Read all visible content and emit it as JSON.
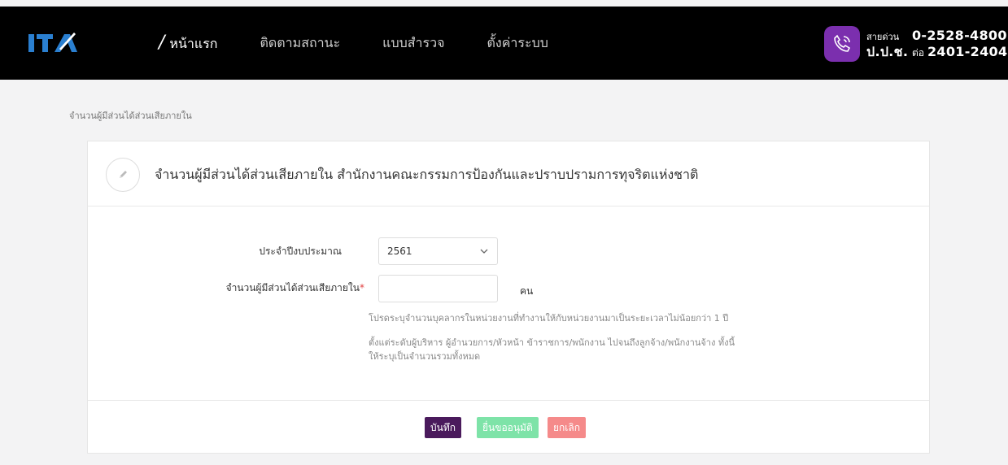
{
  "header": {
    "logo_text": "ITA",
    "nav": [
      {
        "label": "หน้าแรก",
        "active": true
      },
      {
        "label": "ติดตามสถานะ",
        "active": false
      },
      {
        "label": "แบบสำรวจ",
        "active": false
      },
      {
        "label": "ตั้งค่าระบบ",
        "active": false
      }
    ],
    "hotline": {
      "label1": "สายด่วน",
      "number1": "0-2528-4800",
      "label2": "ป.ป.ช.",
      "ext_label": "ต่อ",
      "number2": "2401-2404",
      "icon": "phone-icon",
      "color": "#7b2fae"
    }
  },
  "breadcrumb": "จำนวนผู้มีส่วนได้ส่วนเสียภายใน",
  "card": {
    "title": "จำนวนผู้มีส่วนได้ส่วนเสียภายใน สำนักงานคณะกรรมการป้องกันและปราบปรามการทุจริตแห่งชาติ",
    "icon": "pencil-icon",
    "fields": {
      "budget_year_label": "ประจำปีงบประมาณ",
      "budget_year_value": "2561",
      "stakeholder_label": "จำนวนผู้มีส่วนได้ส่วนเสียภายใน",
      "stakeholder_required": "*",
      "stakeholder_value": "",
      "unit": "คน"
    },
    "help": [
      "โปรดระบุจำนวนบุคลากรในหน่วยงานที่ทำงานให้กับหน่วยงานมาเป็นระยะเวลาไม่น้อยกว่า 1 ปี",
      "ตั้งแต่ระดับผู้บริหาร ผู้อำนวยการ/หัวหน้า ข้าราชการ/พนักงาน ไปจนถึงลูกจ้าง/พนักงานจ้าง ทั้งนี้",
      "ให้ระบุเป็นจำนวนรวมทั้งหมด"
    ],
    "buttons": {
      "save": "บันทึก",
      "submit": "ยื่นขออนุมัติ",
      "cancel": "ยกเลิก"
    },
    "colors": {
      "save": "#4a1a5c",
      "submit": "#7ee3a8",
      "cancel": "#f58a8a"
    }
  }
}
